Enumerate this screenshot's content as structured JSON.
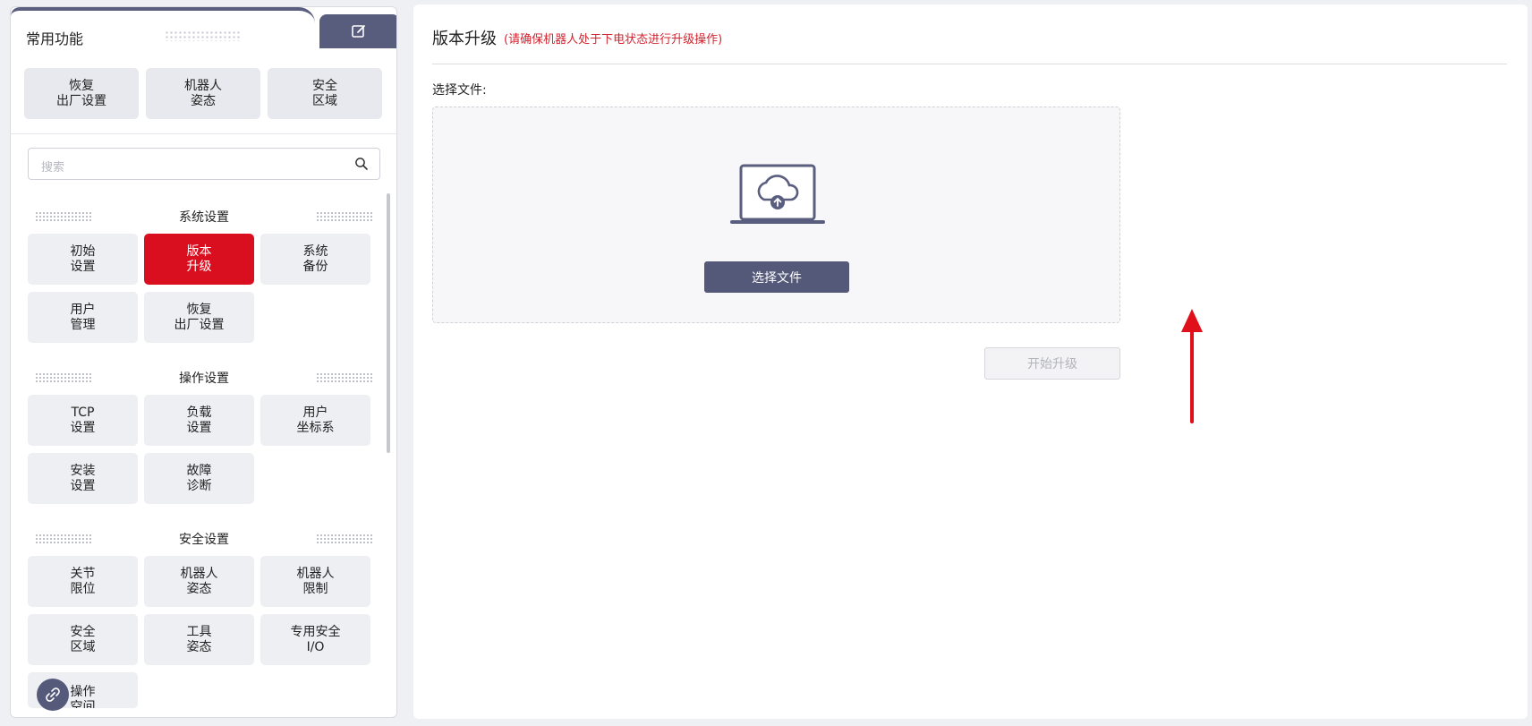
{
  "sidebar": {
    "active_tab": "常用功能",
    "quick_buttons": [
      "恢复\n出厂设置",
      "机器人\n姿态",
      "安全\n区域"
    ],
    "search_placeholder": "搜索",
    "sections": [
      {
        "title": "系统设置",
        "items": [
          "初始\n设置",
          "版本\n升级",
          "系统\n备份",
          "用户\n管理",
          "恢复\n出厂设置"
        ]
      },
      {
        "title": "操作设置",
        "items": [
          "TCP\n设置",
          "负载\n设置",
          "用户\n坐标系",
          "安装\n设置",
          "故障\n诊断"
        ]
      },
      {
        "title": "安全设置",
        "items": [
          "关节\n限位",
          "机器人\n姿态",
          "机器人\n限制",
          "安全\n区域",
          "工具\n姿态",
          "专用安全\nI/O",
          "操作\n空间"
        ]
      }
    ],
    "active_item": "版本\n升级",
    "icons": {
      "edit": "edit-icon",
      "search": "search-icon",
      "fab": "link-icon"
    }
  },
  "main": {
    "title": "版本升级",
    "subtitle": "(请确保机器人处于下电状态进行升级操作)",
    "file_label": "选择文件:",
    "select_file_button": "选择文件",
    "start_upgrade_button": "开始升级",
    "illustration": "cloud-upload-laptop-icon"
  },
  "colors": {
    "accent": "#545879",
    "active_red": "#d90f1f",
    "warning_text": "#d4232f",
    "annotation_arrow": "#e0101b"
  }
}
